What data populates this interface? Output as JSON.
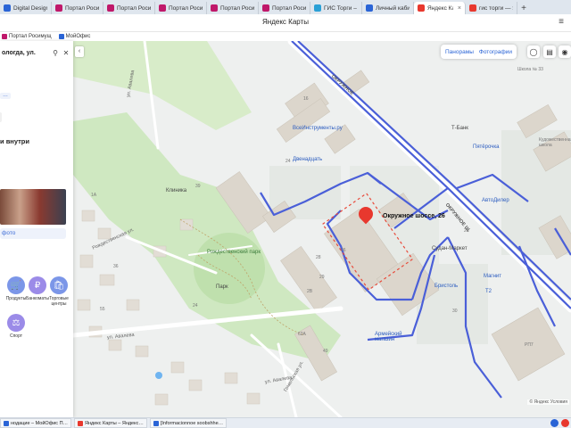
{
  "browser": {
    "tabs": [
      {
        "label": "Digital Design У",
        "color": "#2a64d6",
        "active": false
      },
      {
        "label": "Портал Росиму",
        "color": "#c0186a",
        "active": false
      },
      {
        "label": "Портал Росиму",
        "color": "#c0186a",
        "active": false
      },
      {
        "label": "Портал Росиму",
        "color": "#c0186a",
        "active": false
      },
      {
        "label": "Портал Росиму",
        "color": "#c0186a",
        "active": false
      },
      {
        "label": "Портал Росиму",
        "color": "#c0186a",
        "active": false
      },
      {
        "label": "ГИС Торги – пр",
        "color": "#2aa0d6",
        "active": false
      },
      {
        "label": "Личный кабин",
        "color": "#2a64d6",
        "active": false
      },
      {
        "label": "Яндекс Кар",
        "color": "#e8382e",
        "active": true
      },
      {
        "label": "гис торги — Ян",
        "color": "#e8382e",
        "active": false
      }
    ],
    "close_glyph": "×",
    "new_tab_glyph": "+",
    "bookmarks": [
      {
        "label": "Портал Росимущ",
        "color": "#c0186a"
      },
      {
        "label": "МойОфис",
        "color": "#2a64d6"
      }
    ]
  },
  "header": {
    "title": "Яндекс Карты",
    "menu_glyph": "≡"
  },
  "panel": {
    "search_value": "ологда, ул.",
    "dots_label": "…",
    "heading": "и внутри",
    "photo_link": "фото",
    "categories": [
      {
        "label": "Продукты",
        "glyph": "🛒",
        "style": "blue"
      },
      {
        "label": "Банкоматы",
        "glyph": "₽",
        "style": "purple"
      },
      {
        "label": "Торговые центры",
        "glyph": "🛍",
        "style": "blue"
      },
      {
        "label": "Спорт",
        "glyph": "⚖",
        "style": "purple"
      }
    ]
  },
  "map_controls": {
    "panoramas": "Панорамы",
    "photos": "Фотографии",
    "collapse_glyph": "‹",
    "copyright": "© Яндекс Условия"
  },
  "map": {
    "selected_address": "Окружное шоссе, 26",
    "pois": [
      {
        "label": "ВсеИнструменты.ру",
        "kind": "blue"
      },
      {
        "label": "Двенадцать",
        "kind": "blue"
      },
      {
        "label": "Клиника",
        "kind": "pink"
      },
      {
        "label": "Рождественский парк",
        "kind": "green"
      },
      {
        "label": "Парк",
        "kind": "orange"
      },
      {
        "label": "Т-Банк",
        "kind": "gray"
      },
      {
        "label": "Пятёрочка",
        "kind": "blue"
      },
      {
        "label": "АвтоДилер",
        "kind": "blue"
      },
      {
        "label": "Судан-Маркет",
        "kind": "orange"
      },
      {
        "label": "Бристоль",
        "kind": "blue"
      },
      {
        "label": "Магнит",
        "kind": "blue"
      },
      {
        "label": "Т2",
        "kind": "blue"
      },
      {
        "label": "Армейский магазин",
        "kind": "blue"
      },
      {
        "label": "Кудожественная школа",
        "kind": "gray"
      },
      {
        "label": "РП7",
        "kind": "gray"
      },
      {
        "label": "Школа № 33",
        "kind": "gray"
      }
    ],
    "roads": [
      {
        "label": "ОКРУЖНОЕ",
        "kind": "dark"
      },
      {
        "label": "ОКРУЖНОЕ Ш.",
        "kind": "dark"
      },
      {
        "label": "ул. Авалева",
        "kind": "gray"
      },
      {
        "label": "Рождественская ул.",
        "kind": "gray"
      },
      {
        "label": "ул. Авалева",
        "kind": "gray"
      },
      {
        "label": "Гомельская ул.",
        "kind": "gray"
      },
      {
        "label": "ул. Авалева",
        "kind": "gray"
      }
    ],
    "house_numbers": [
      "39",
      "36",
      "55",
      "1A",
      "24",
      "26",
      "28",
      "29",
      "2B",
      "24",
      "62A",
      "16",
      "49",
      "28",
      "30"
    ]
  },
  "taskbar": {
    "items": [
      {
        "label": "нодацие – МойОфис П…",
        "color": "#2a64d6"
      },
      {
        "label": "Яндекс Карты – Яндекс…",
        "color": "#e8382e"
      },
      {
        "label": "[Informacionnoe soobshhe…",
        "color": "#2a64d6"
      }
    ]
  }
}
